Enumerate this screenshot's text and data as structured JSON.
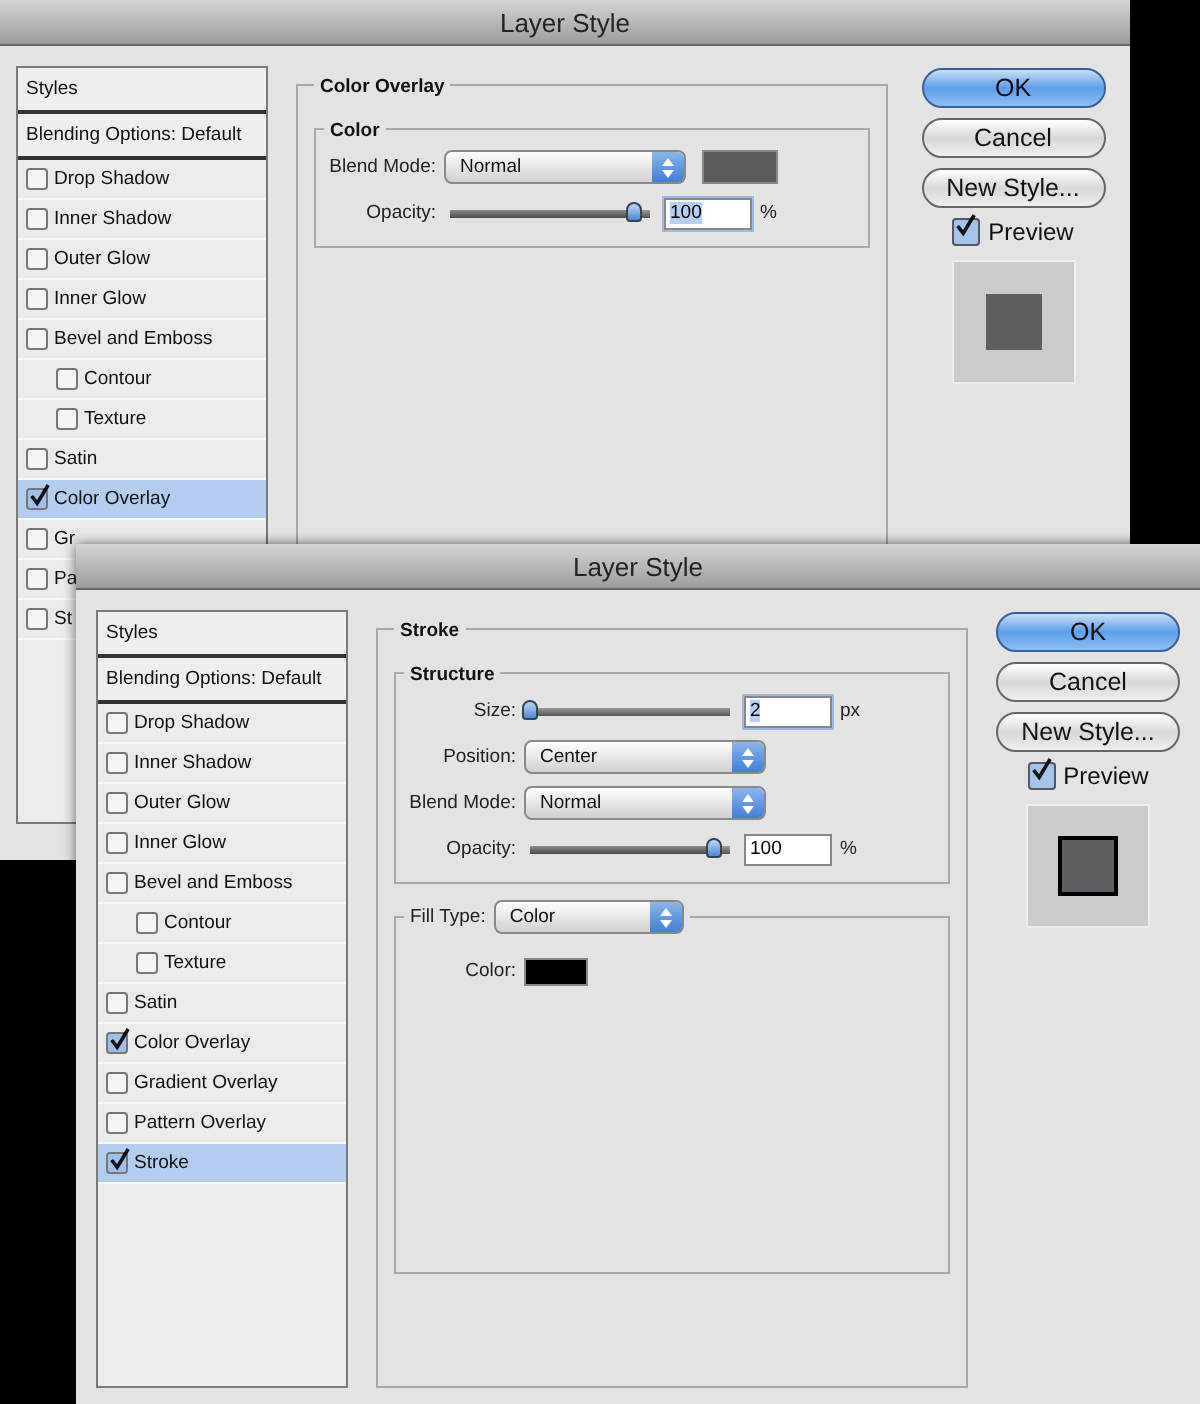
{
  "windows": [
    {
      "title": "Layer Style",
      "styles_header": "Styles",
      "blending": "Blending Options: Default",
      "items": [
        {
          "label": "Drop Shadow",
          "checked": false,
          "selected": false
        },
        {
          "label": "Inner Shadow",
          "checked": false,
          "selected": false
        },
        {
          "label": "Outer Glow",
          "checked": false,
          "selected": false
        },
        {
          "label": "Inner Glow",
          "checked": false,
          "selected": false
        },
        {
          "label": "Bevel and Emboss",
          "checked": false,
          "selected": false,
          "children": [
            {
              "label": "Contour",
              "checked": false,
              "selected": false
            },
            {
              "label": "Texture",
              "checked": false,
              "selected": false
            }
          ]
        },
        {
          "label": "Satin",
          "checked": false,
          "selected": false
        },
        {
          "label": "Color Overlay",
          "checked": true,
          "selected": true
        },
        {
          "label": "Gr",
          "checked": false,
          "selected": false
        },
        {
          "label": "Pa",
          "checked": false,
          "selected": false
        },
        {
          "label": "St",
          "checked": false,
          "selected": false
        }
      ],
      "panel": {
        "title": "Color Overlay",
        "groups": [
          {
            "title": "Color",
            "rows": [
              {
                "kind": "select",
                "label": "Blend Mode:",
                "value": "Normal",
                "has_swatch": true
              },
              {
                "kind": "slider",
                "label": "Opacity:",
                "level": 1,
                "value": "100",
                "unit": "%",
                "focused": true
              }
            ]
          }
        ]
      },
      "buttons": [
        {
          "label": "OK",
          "default": true
        },
        {
          "label": "Cancel",
          "default": false
        },
        {
          "label": "New Style...",
          "default": false
        }
      ],
      "preview": {
        "label": "Preview",
        "checked": true,
        "stroke": false
      }
    },
    {
      "title": "Layer Style",
      "styles_header": "Styles",
      "blending": "Blending Options: Default",
      "items": [
        {
          "label": "Drop Shadow",
          "checked": false,
          "selected": false
        },
        {
          "label": "Inner Shadow",
          "checked": false,
          "selected": false
        },
        {
          "label": "Outer Glow",
          "checked": false,
          "selected": false
        },
        {
          "label": "Inner Glow",
          "checked": false,
          "selected": false
        },
        {
          "label": "Bevel and Emboss",
          "checked": false,
          "selected": false,
          "children": [
            {
              "label": "Contour",
              "checked": false,
              "selected": false
            },
            {
              "label": "Texture",
              "checked": false,
              "selected": false
            }
          ]
        },
        {
          "label": "Satin",
          "checked": false,
          "selected": false
        },
        {
          "label": "Color Overlay",
          "checked": true,
          "selected": false
        },
        {
          "label": "Gradient Overlay",
          "checked": false,
          "selected": false
        },
        {
          "label": "Pattern Overlay",
          "checked": false,
          "selected": false
        },
        {
          "label": "Stroke",
          "checked": true,
          "selected": true
        }
      ],
      "panel": {
        "title": "Stroke",
        "groups": [
          {
            "title": "Structure",
            "rows": [
              {
                "kind": "slider",
                "label": "Size:",
                "level": 0,
                "value": "2",
                "unit": "px",
                "focused": true
              },
              {
                "kind": "select",
                "label": "Position:",
                "value": "Center"
              },
              {
                "kind": "select",
                "label": "Blend Mode:",
                "value": "Normal"
              },
              {
                "kind": "slider",
                "label": "Opacity:",
                "level": 1,
                "value": "100",
                "unit": "%",
                "focused": false
              }
            ]
          },
          {
            "title_select": {
              "label": "Fill Type:",
              "value": "Color"
            },
            "rows": [
              {
                "kind": "swatch",
                "label": "Color:"
              }
            ]
          }
        ]
      },
      "buttons": [
        {
          "label": "OK",
          "default": true
        },
        {
          "label": "Cancel",
          "default": false
        },
        {
          "label": "New Style...",
          "default": false
        }
      ],
      "preview": {
        "label": "Preview",
        "checked": true,
        "stroke": true
      }
    }
  ]
}
